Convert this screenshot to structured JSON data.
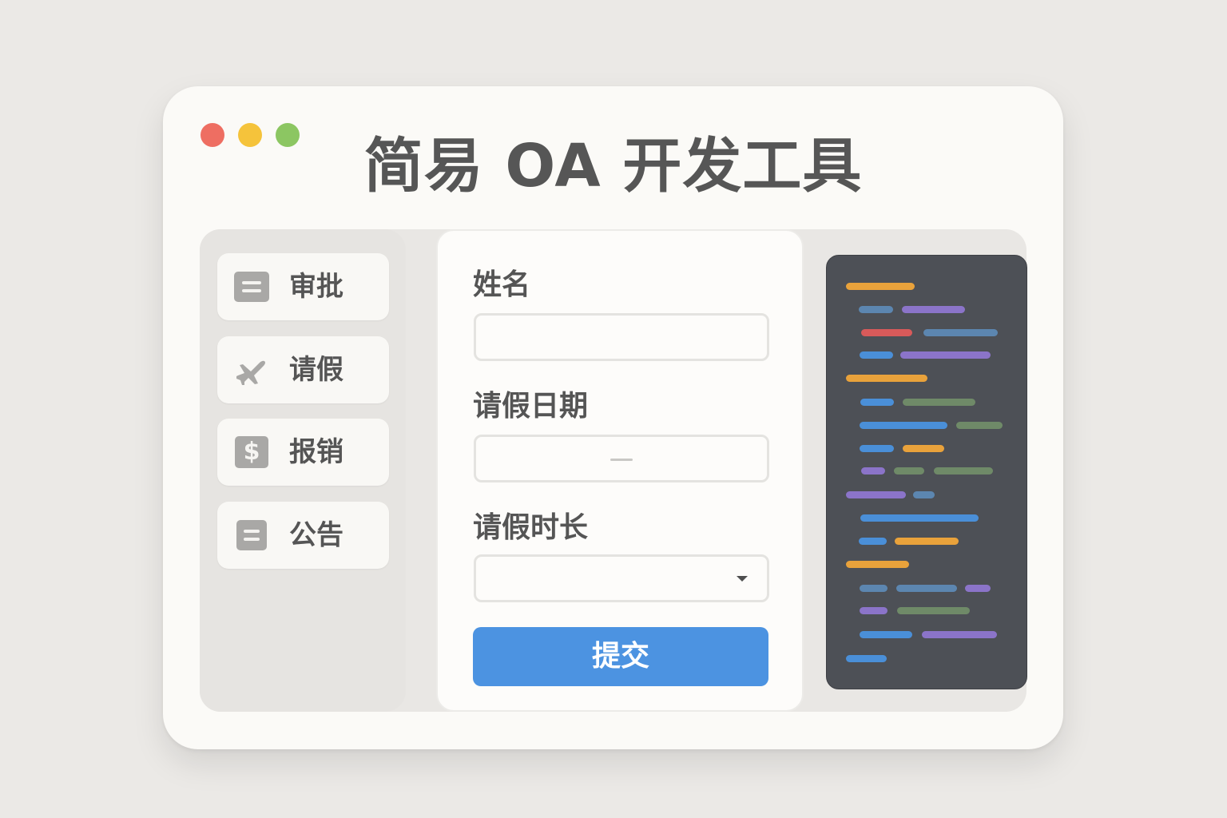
{
  "app": {
    "title": "简易 OA 开发工具"
  },
  "sidebar": {
    "items": [
      {
        "label": "审批",
        "icon": "document-icon"
      },
      {
        "label": "请假",
        "icon": "airplane-icon"
      },
      {
        "label": "报销",
        "icon": "dollar-icon"
      },
      {
        "label": "公告",
        "icon": "notice-icon"
      }
    ]
  },
  "form": {
    "name_label": "姓名",
    "name_value": "",
    "date_label": "请假日期",
    "date_value": "",
    "duration_label": "请假时长",
    "duration_value": "",
    "submit_label": "提交"
  },
  "colors": {
    "accent": "#4c93e1",
    "traffic_red": "#ee6e62",
    "traffic_yellow": "#f5c33b",
    "traffic_green": "#8cc662",
    "code_orange": "#e9a23b",
    "code_blue": "#4a8fd8",
    "code_purple": "#8b74c9",
    "code_red": "#d85a5a",
    "code_green": "#6f8a68",
    "code_slate": "#5c86b0"
  }
}
